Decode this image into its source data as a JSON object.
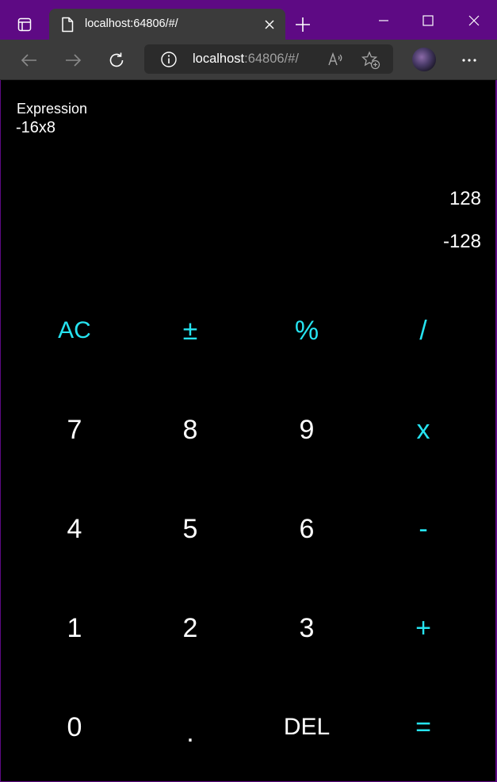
{
  "browser": {
    "tab_title": "localhost:64806/#/",
    "url_host": "localhost",
    "url_rest": ":64806/#/",
    "accent_color": "#5e0a84"
  },
  "calculator": {
    "expression_label": "Expression",
    "expression_value": "-16x8",
    "result_primary": "128",
    "result_secondary": "-128",
    "accent_color": "#26e3f0",
    "keys": {
      "ac": "AC",
      "plus_minus": "±",
      "percent": "%",
      "divide": "/",
      "seven": "7",
      "eight": "8",
      "nine": "9",
      "multiply": "x",
      "four": "4",
      "five": "5",
      "six": "6",
      "minus": "-",
      "one": "1",
      "two": "2",
      "three": "3",
      "plus": "+",
      "zero": "0",
      "dot": ".",
      "del": "DEL",
      "equals": "="
    }
  }
}
